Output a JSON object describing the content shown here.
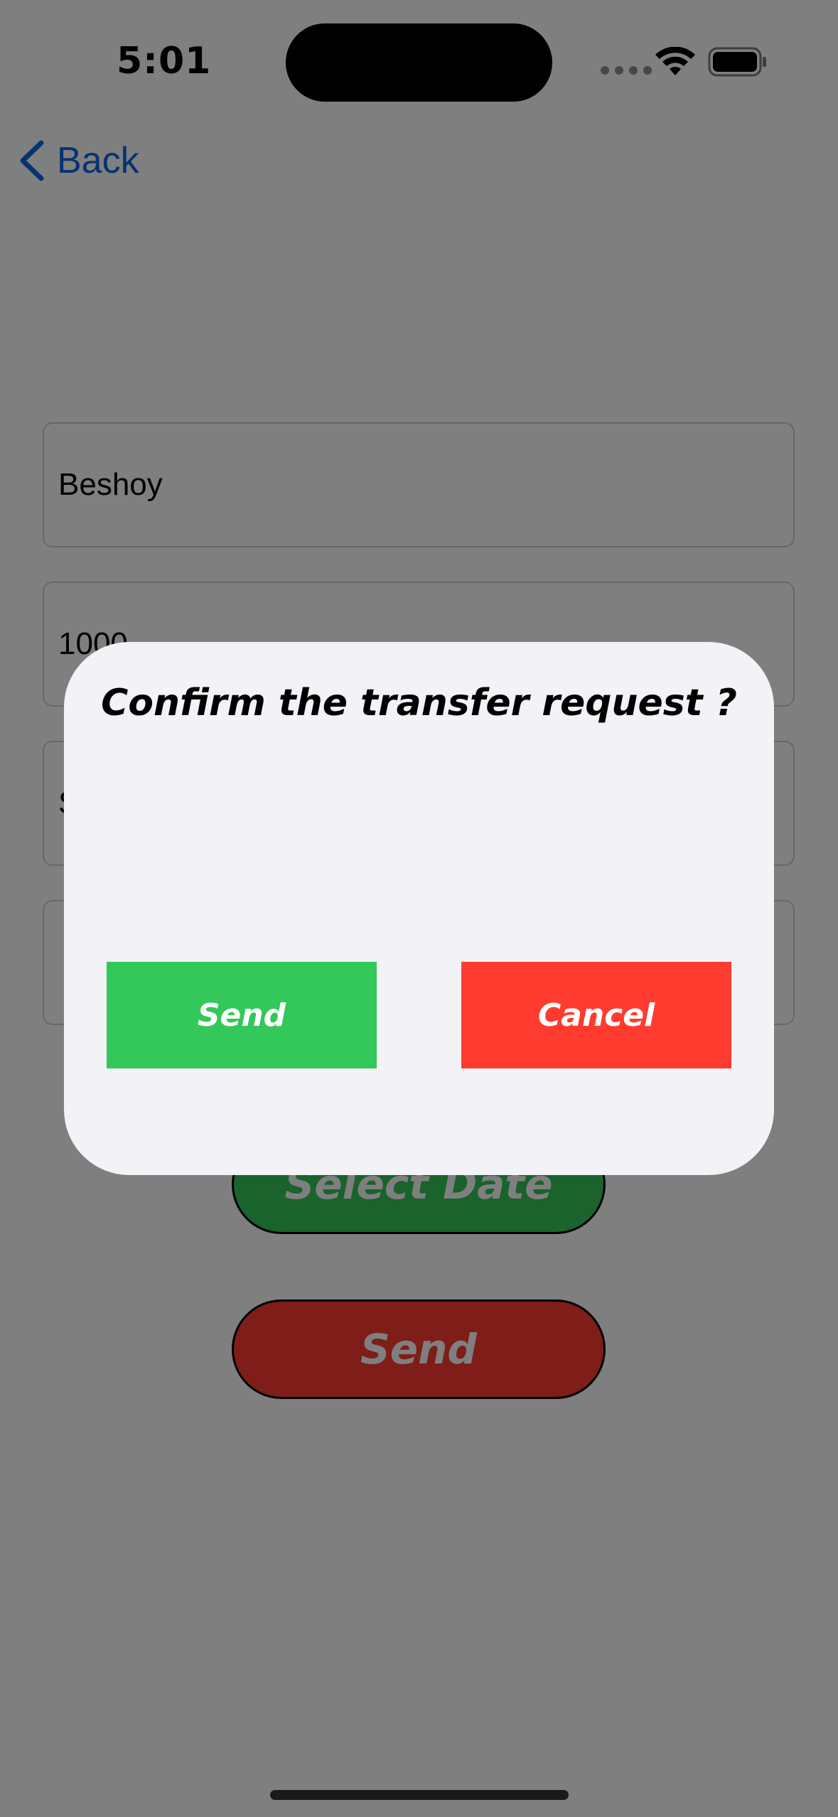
{
  "status_bar": {
    "time": "5:01",
    "icons": [
      "signal-dots-icon",
      "wifi-icon",
      "battery-icon"
    ]
  },
  "nav": {
    "back_label": "Back",
    "back_icon": "chevron-left-icon"
  },
  "form": {
    "fields": [
      {
        "value": "Beshoy"
      },
      {
        "value": "1000"
      },
      {
        "value": "S"
      },
      {
        "value": ""
      }
    ],
    "select_date_label": "Select Date",
    "send_label": "Send"
  },
  "dialog": {
    "title": "Confirm the transfer request ?",
    "send_label": "Send",
    "cancel_label": "Cancel"
  },
  "colors": {
    "accent": "#0a66e6",
    "green": "#34c759",
    "red": "#ff3b30",
    "dialog_bg": "#f2f2f7"
  }
}
